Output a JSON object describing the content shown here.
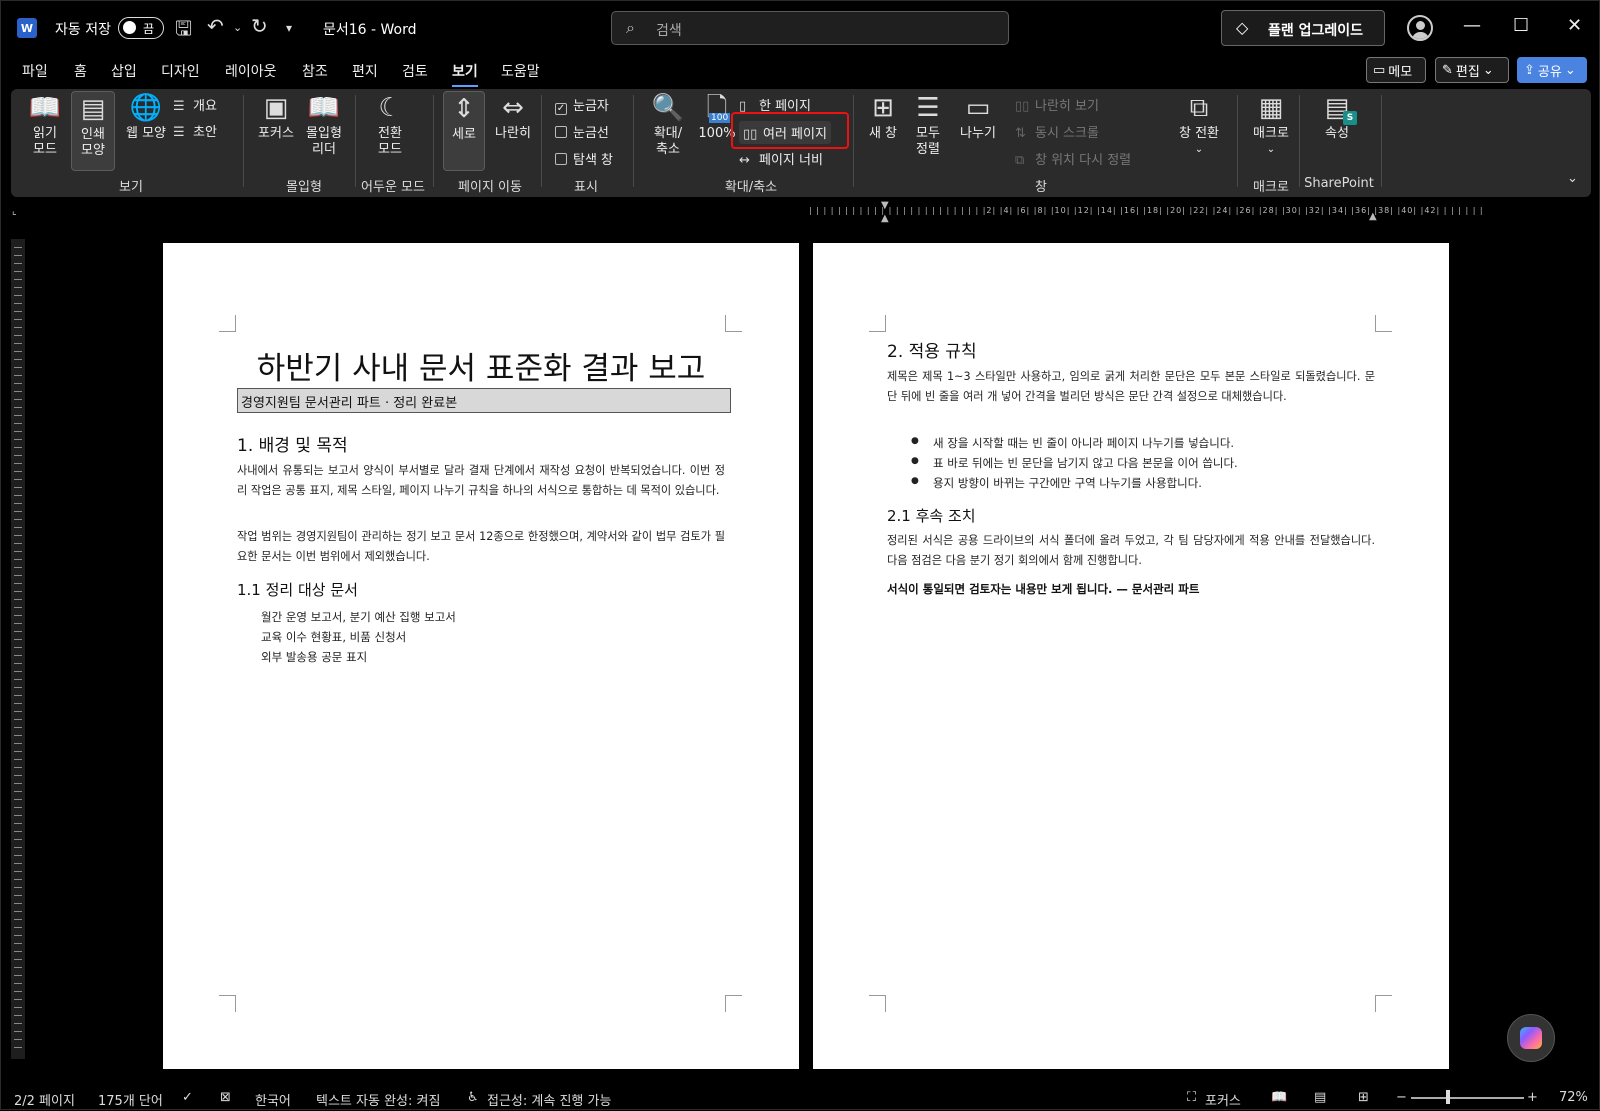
{
  "titlebar": {
    "app_icon": "W",
    "autosave_label": "자동 저장",
    "autosave_state": "끔",
    "doc_title": "문서16  -  Word",
    "search_placeholder": "검색",
    "upgrade_label": "플랜 업그레이드"
  },
  "tabs": [
    "파일",
    "홈",
    "삽입",
    "디자인",
    "레이아웃",
    "참조",
    "편지",
    "검토",
    "보기",
    "도움말"
  ],
  "active_tab": "보기",
  "actions": {
    "memo": "메모",
    "edit": "편집",
    "share": "공유"
  },
  "ribbon": {
    "view": {
      "read_mode": "읽기\n모드",
      "print_layout": "인쇄\n모양",
      "web_layout": "웹 모양",
      "outline": "개요",
      "draft": "초안",
      "group": "보기"
    },
    "immersive": {
      "focus": "포커스",
      "reader": "몰입형\n리더",
      "group": "몰입형"
    },
    "dark": {
      "switch": "전환\n모드",
      "group": "어두운 모드"
    },
    "page_move": {
      "vertical": "세로",
      "side": "나란히",
      "group": "페이지 이동"
    },
    "show": {
      "ruler": "눈금자",
      "gridlines": "눈금선",
      "nav_pane": "탐색 창",
      "ruler_checked": true,
      "group": "표시"
    },
    "zoom": {
      "zoom": "확대/\n축소",
      "hundred": "100%",
      "hundred_badge": "100",
      "one_page": "한 페이지",
      "multi_page": "여러 페이지",
      "page_width": "페이지 너비",
      "group": "확대/축소"
    },
    "window": {
      "new_window": "새 창",
      "arrange_all": "모두\n정렬",
      "split": "나누기",
      "side_by_side": "나란히 보기",
      "sync_scroll": "동시 스크롤",
      "reset_pos": "창 위치 다시 정렬",
      "switch_windows": "창 전환",
      "group": "창"
    },
    "macros": {
      "macros": "매크로",
      "group": "매크로"
    },
    "sharepoint": {
      "props": "속성",
      "group": "SharePoint"
    }
  },
  "ruler_ticks": "| | | | | | | | | | | | | | | | | | | | | | | | |2| |4| |6| |8| |10| |12| |14| |16| |18| |20| |22| |24| |26| |28| |30| |32| |34| |36| |38| |40| |42| | | | | | |",
  "page1": {
    "title": "하반기 사내 문서 표준화 결과 보고",
    "subtitle": "경영지원팀 문서관리 파트 · 정리 완료본",
    "h1": "1. 배경 및 목적",
    "p1": "사내에서 유통되는 보고서 양식이 부서별로 달라 결재 단계에서 재작성 요청이 반복되었습니다. 이번 정리 작업은 공통 표지, 제목 스타일, 페이지 나누기 규칙을 하나의 서식으로 통합하는 데 목적이 있습니다.",
    "p2": "작업 범위는 경영지원팀이 관리하는 정기 보고 문서 12종으로 한정했으며, 계약서와 같이 법무 검토가 필요한 문서는 이번 범위에서 제외했습니다.",
    "h2": "1.1 정리 대상 문서",
    "items": [
      "월간 운영 보고서, 분기 예산 집행 보고서",
      "교육 이수 현황표, 비품 신청서",
      "외부 발송용 공문 표지"
    ]
  },
  "page2": {
    "h1": "2. 적용 규칙",
    "p1": "제목은 제목 1~3 스타일만 사용하고, 임의로 굵게 처리한 문단은 모두 본문 스타일로 되돌렸습니다. 문단 뒤에 빈 줄을 여러 개 넣어 간격을 벌리던 방식은 문단 간격 설정으로 대체했습니다.",
    "bullets": [
      "새 장을 시작할 때는 빈 줄이 아니라 페이지 나누기를 넣습니다.",
      "표 바로 뒤에는 빈 문단을 남기지 않고 다음 본문을 이어 씁니다.",
      "용지 방향이 바뀌는 구간에만 구역 나누기를 사용합니다."
    ],
    "h2": "2.1 후속 조치",
    "p2": "정리된 서식은 공용 드라이브의 서식 폴더에 올려 두었고, 각 팀 담당자에게 적용 안내를 전달했습니다. 다음 점검은 다음 분기 정기 회의에서 함께 진행합니다.",
    "closing": "서식이 통일되면 검토자는 내용만 보게 됩니다. — 문서관리 파트"
  },
  "status": {
    "page": "2/2 페이지",
    "words": "175개 단어",
    "language": "한국어",
    "autocomplete": "텍스트 자동 완성: 켜짐",
    "accessibility": "접근성: 계속 진행 가능",
    "focus": "포커스",
    "zoom": "72%"
  }
}
